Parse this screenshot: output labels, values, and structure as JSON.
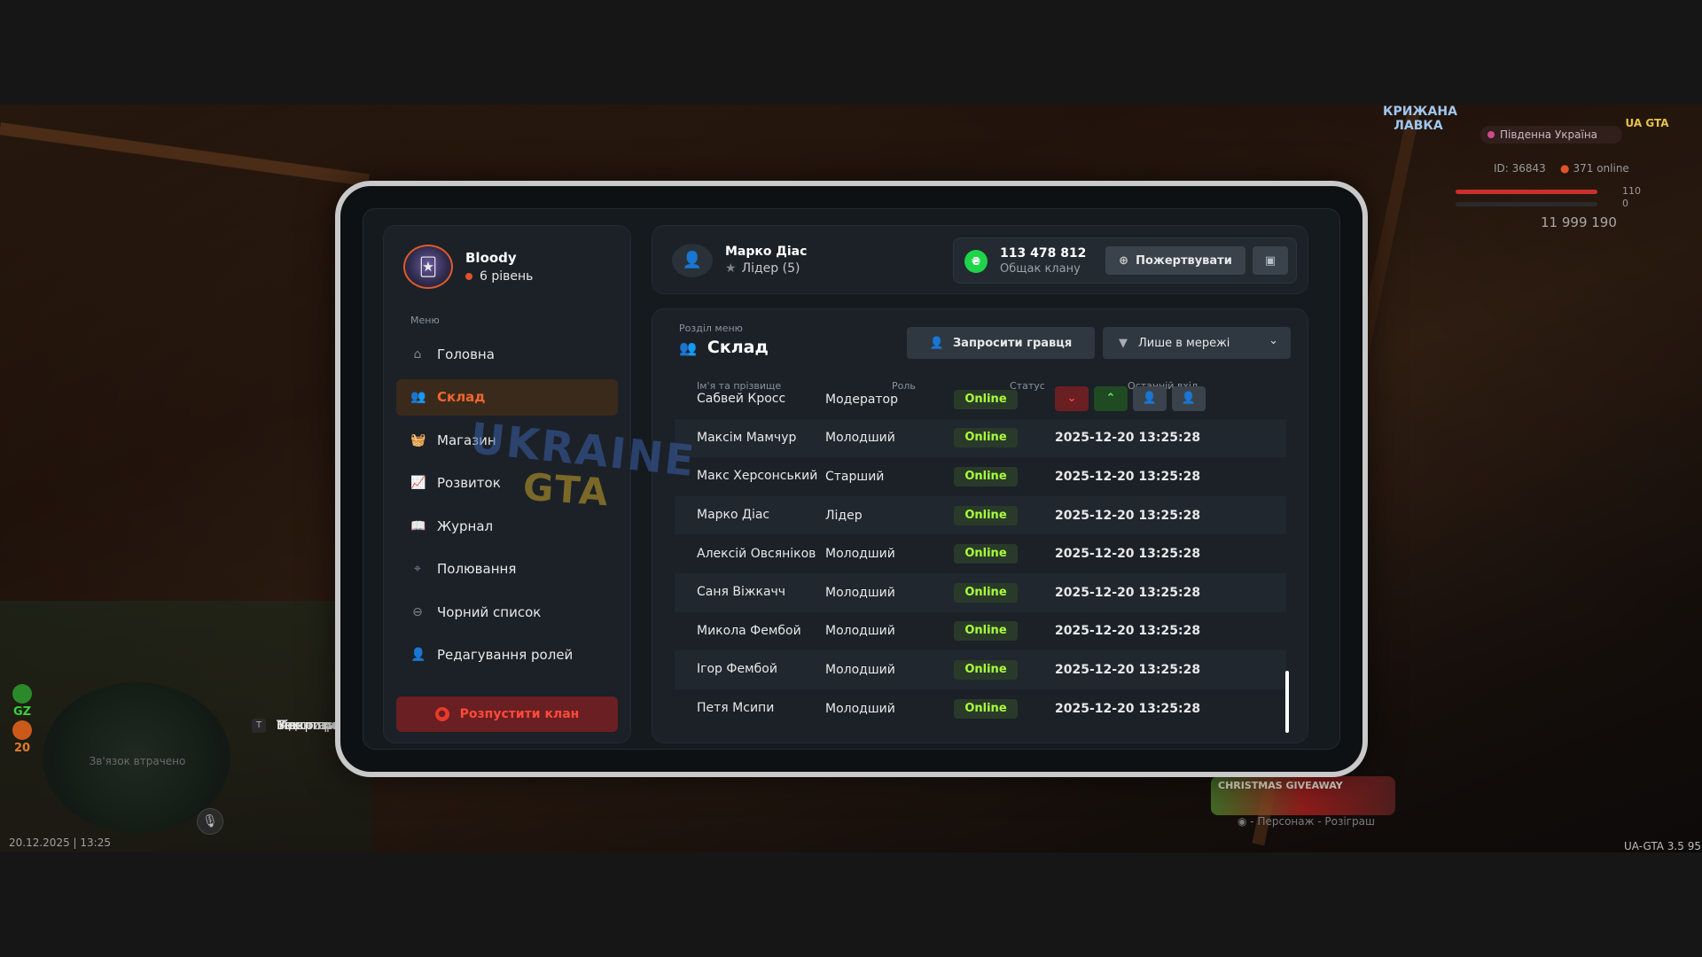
{
  "hud": {
    "top_logo": "КРИЖАНА ЛАВКА",
    "server_name": "Південна Україна",
    "corner_logo": "UA GTA",
    "player_id": "ID: 36843",
    "online_count": "371 online",
    "health": "110",
    "armor": "0",
    "money": "11 999 190",
    "minimap_text": "Зв'язок втрачено",
    "gz_label": "GZ",
    "gz_value": "20",
    "datetime": "20.12.2025 | 13:25",
    "keys": [
      {
        "key": "O",
        "label": "Меню гра"
      },
      {
        "key": "P",
        "label": "Відкрити"
      },
      {
        "key": "I",
        "label": "Інвентар"
      },
      {
        "key": "T",
        "label": "Текстовий чат"
      }
    ],
    "mic_key": "R",
    "giveaway_title": "CHRISTMAS GIVEAWAY",
    "giveaway_caption": "- Персонаж - Розіграш",
    "version": "UA-GTA 3.5",
    "fps": "95"
  },
  "sidebar": {
    "player_name": "Bloody",
    "player_level": "6 рівень",
    "menu_title": "Меню",
    "items": [
      {
        "label": "Головна",
        "icon": "home-icon",
        "glyph": "⌂"
      },
      {
        "label": "Склад",
        "icon": "group-icon",
        "glyph": "👥"
      },
      {
        "label": "Магазин",
        "icon": "basket-icon",
        "glyph": "🧺"
      },
      {
        "label": "Розвиток",
        "icon": "chart-icon",
        "glyph": "📈"
      },
      {
        "label": "Журнал",
        "icon": "book-icon",
        "glyph": "📖"
      },
      {
        "label": "Полювання",
        "icon": "crosshair-icon",
        "glyph": "⌖"
      },
      {
        "label": "Чорний список",
        "icon": "block-icon",
        "glyph": "⊖"
      },
      {
        "label": "Редагування ролей",
        "icon": "user-edit-icon",
        "glyph": "👤"
      }
    ],
    "disband_label": "Розпустити клан"
  },
  "topbar": {
    "leader_name": "Марко Діас",
    "leader_role": "Лідер (5)",
    "bank_amount": "113 478 812",
    "bank_label": "Общак клану",
    "donate_label": "Пожертвувати"
  },
  "panel": {
    "section_label": "Розділ меню",
    "section_title": "Склад",
    "invite_label": "Запросити гравця",
    "filter_label": "Лише в мережі",
    "columns": {
      "name": "Ім'я та прізвище",
      "role": "Роль",
      "status": "Статус",
      "last": "Останній вхід"
    },
    "members": [
      {
        "name": "Сабвей Кросс",
        "role": "Модератор",
        "status": "Online",
        "last": ""
      },
      {
        "name": "Максім Мамчур",
        "role": "Молодший",
        "status": "Online",
        "last": "2025-12-20 13:25:28"
      },
      {
        "name": "Макс Херсонський",
        "role": "Старший",
        "status": "Online",
        "last": "2025-12-20 13:25:28"
      },
      {
        "name": "Марко Діас",
        "role": "Лідер",
        "status": "Online",
        "last": "2025-12-20 13:25:28"
      },
      {
        "name": "Алексій Овсяніков",
        "role": "Молодший",
        "status": "Online",
        "last": "2025-12-20 13:25:28"
      },
      {
        "name": "Саня Віжкачч",
        "role": "Молодший",
        "status": "Online",
        "last": "2025-12-20 13:25:28"
      },
      {
        "name": "Микола Фембой",
        "role": "Молодший",
        "status": "Online",
        "last": "2025-12-20 13:25:28"
      },
      {
        "name": "Ігор Фембой",
        "role": "Молодший",
        "status": "Online",
        "last": "2025-12-20 13:25:28"
      },
      {
        "name": "Петя Мсипи",
        "role": "Молодший",
        "status": "Online",
        "last": "2025-12-20 13:25:28"
      }
    ],
    "row_actions": [
      "demote",
      "promote",
      "kick",
      "transfer"
    ]
  },
  "watermark": {
    "line1": "UKRAINE",
    "line2": "GTA"
  },
  "colors": {
    "accent": "#f0652e",
    "online": "#a8ff3a",
    "danger": "#ff4a3a",
    "bank": "#1fd34a"
  }
}
